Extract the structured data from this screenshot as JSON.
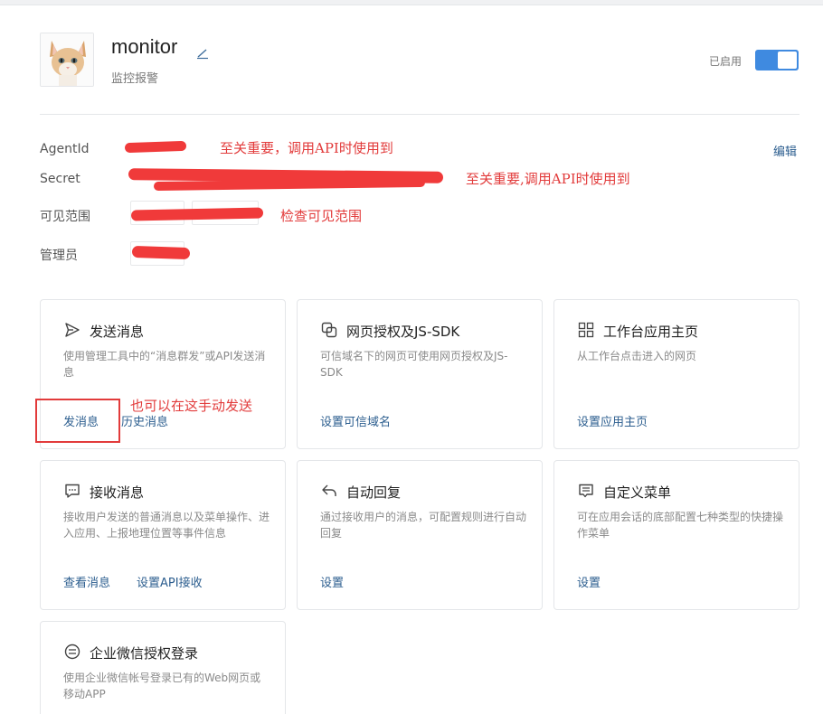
{
  "app": {
    "name": "monitor",
    "description": "监控报警",
    "status_label": "已启用",
    "enabled": true
  },
  "info": {
    "edit_label": "编辑",
    "rows": [
      {
        "label": "AgentId",
        "note": "至关重要，调用API时使用到"
      },
      {
        "label": "Secret",
        "note": "至关重要,调用API时使用到"
      },
      {
        "label": "可见范围",
        "note": "检查可见范围"
      },
      {
        "label": "管理员"
      }
    ]
  },
  "cards": [
    {
      "title": "发送消息",
      "icon": "send-icon",
      "desc": "使用管理工具中的“消息群发”或API发送消息",
      "links": [
        "发消息",
        "历史消息"
      ]
    },
    {
      "title": "网页授权及JS-SDK",
      "icon": "copy-icon",
      "desc": "可信域名下的网页可使用网页授权及JS-SDK",
      "links": [
        "设置可信域名"
      ]
    },
    {
      "title": "工作台应用主页",
      "icon": "grid-icon",
      "desc": "从工作台点击进入的网页",
      "links": [
        "设置应用主页"
      ]
    },
    {
      "title": "接收消息",
      "icon": "chat-icon",
      "desc": "接收用户发送的普通消息以及菜单操作、进入应用、上报地理位置等事件信息",
      "links": [
        "查看消息",
        "设置API接收"
      ]
    },
    {
      "title": "自动回复",
      "icon": "reply-icon",
      "desc": "通过接收用户的消息，可配置规则进行自动回复",
      "links": [
        "设置"
      ]
    },
    {
      "title": "自定义菜单",
      "icon": "menu-icon",
      "desc": "可在应用会话的底部配置七种类型的快捷操作菜单",
      "links": [
        "设置"
      ]
    },
    {
      "title": "企业微信授权登录",
      "icon": "login-icon",
      "desc": "使用企业微信帐号登录已有的Web网页或移动APP",
      "links": []
    }
  ],
  "annotation": {
    "send_hint": "也可以在这手动发送"
  },
  "colors": {
    "accent": "#3f8ae0",
    "link": "#2c5e8f",
    "annotation": "#e23b3b"
  }
}
